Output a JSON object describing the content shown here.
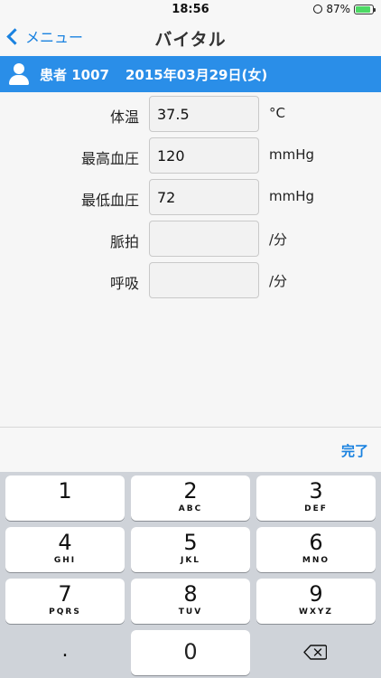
{
  "status_bar": {
    "time": "18:56",
    "battery": "87%",
    "battery_level": 0.87
  },
  "nav": {
    "back_label": "メニュー",
    "title": "バイタル"
  },
  "patient": {
    "name": "患者 1007",
    "birth": "2015年03月29日(女)"
  },
  "vitals": [
    {
      "label": "体温",
      "value": "37.5",
      "unit": "°C"
    },
    {
      "label": "最高血圧",
      "value": "120",
      "unit": "mmHg"
    },
    {
      "label": "最低血圧",
      "value": "72",
      "unit": "mmHg"
    },
    {
      "label": "脈拍",
      "value": "",
      "unit": "/分"
    },
    {
      "label": "呼吸",
      "value": "",
      "unit": "/分"
    }
  ],
  "toolbar": {
    "done_label": "完了"
  },
  "keypad": [
    {
      "num": "1",
      "letters": ""
    },
    {
      "num": "2",
      "letters": "ABC"
    },
    {
      "num": "3",
      "letters": "DEF"
    },
    {
      "num": "4",
      "letters": "GHI"
    },
    {
      "num": "5",
      "letters": "JKL"
    },
    {
      "num": "6",
      "letters": "MNO"
    },
    {
      "num": "7",
      "letters": "PQRS"
    },
    {
      "num": "8",
      "letters": "TUV"
    },
    {
      "num": "9",
      "letters": "WXYZ"
    }
  ],
  "keypad_bottom": {
    "dot": ".",
    "zero": "0"
  },
  "colors": {
    "accent": "#1a82e0",
    "header": "#2a8ee8"
  }
}
